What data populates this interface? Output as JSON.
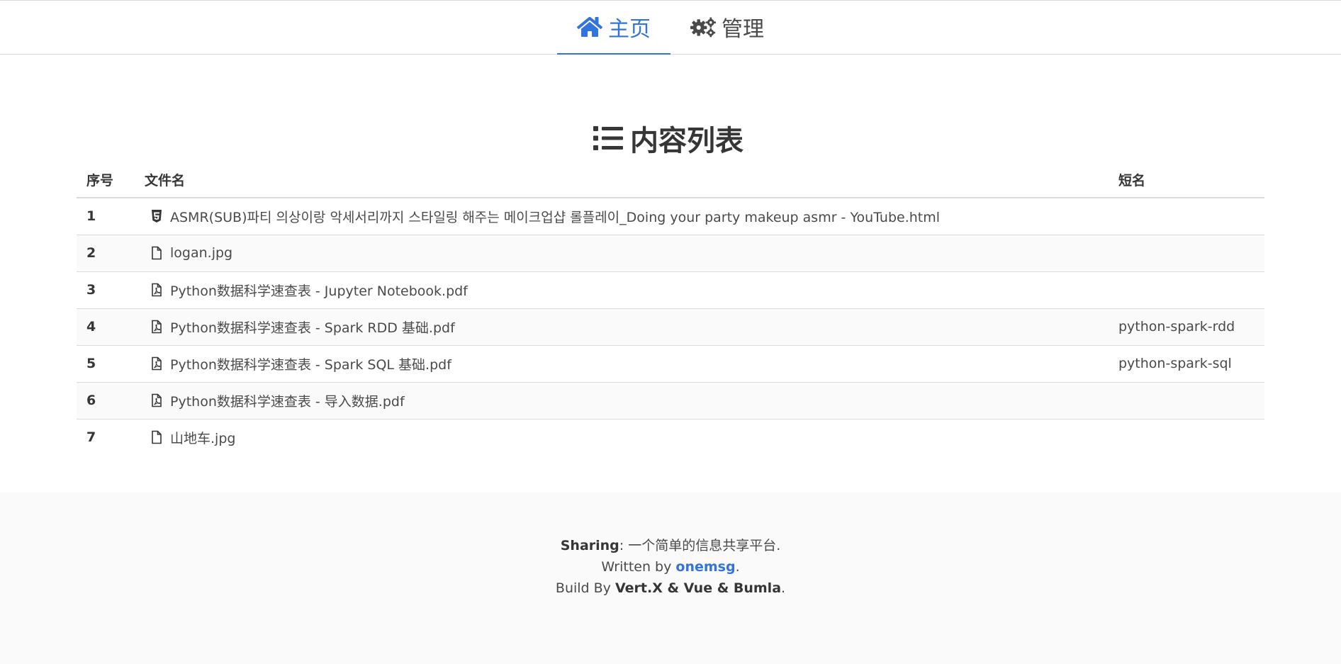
{
  "nav": {
    "tabs": [
      {
        "label": "主页",
        "icon": "home-icon",
        "active": true
      },
      {
        "label": "管理",
        "icon": "gears-icon",
        "active": false
      }
    ]
  },
  "page": {
    "title": "内容列表",
    "title_icon": "list-icon"
  },
  "table": {
    "headers": [
      "序号",
      "文件名",
      "短名"
    ],
    "rows": [
      {
        "index": "1",
        "icon": "html5-icon",
        "name": "ASMR(SUB)파티 의상이랑 악세서리까지 스타일링 해주는 메이크업샵 롤플레이_Doing your party makeup asmr - YouTube.html",
        "short": ""
      },
      {
        "index": "2",
        "icon": "file-icon",
        "name": "logan.jpg",
        "short": ""
      },
      {
        "index": "3",
        "icon": "file-pdf-icon",
        "name": "Python数据科学速查表 - Jupyter Notebook.pdf",
        "short": ""
      },
      {
        "index": "4",
        "icon": "file-pdf-icon",
        "name": "Python数据科学速查表 - Spark RDD 基础.pdf",
        "short": "python-spark-rdd"
      },
      {
        "index": "5",
        "icon": "file-pdf-icon",
        "name": "Python数据科学速查表 - Spark SQL 基础.pdf",
        "short": "python-spark-sql"
      },
      {
        "index": "6",
        "icon": "file-pdf-icon",
        "name": "Python数据科学速查表 - 导入数据.pdf",
        "short": ""
      },
      {
        "index": "7",
        "icon": "file-icon",
        "name": "山地车.jpg",
        "short": ""
      }
    ]
  },
  "footer": {
    "brand": "Sharing",
    "tagline": ": 一个简单的信息共享平台.",
    "written_by_prefix": "Written by ",
    "author": "onemsg",
    "written_by_suffix": ".",
    "build_prefix": "Build By ",
    "build_stack": "Vert.X & Vue & Bumla",
    "build_suffix": "."
  },
  "colors": {
    "accent": "#3273dc",
    "text": "#4a4a4a",
    "heading": "#363636",
    "border": "#dbdbdb",
    "footer_bg": "#fafafa"
  }
}
